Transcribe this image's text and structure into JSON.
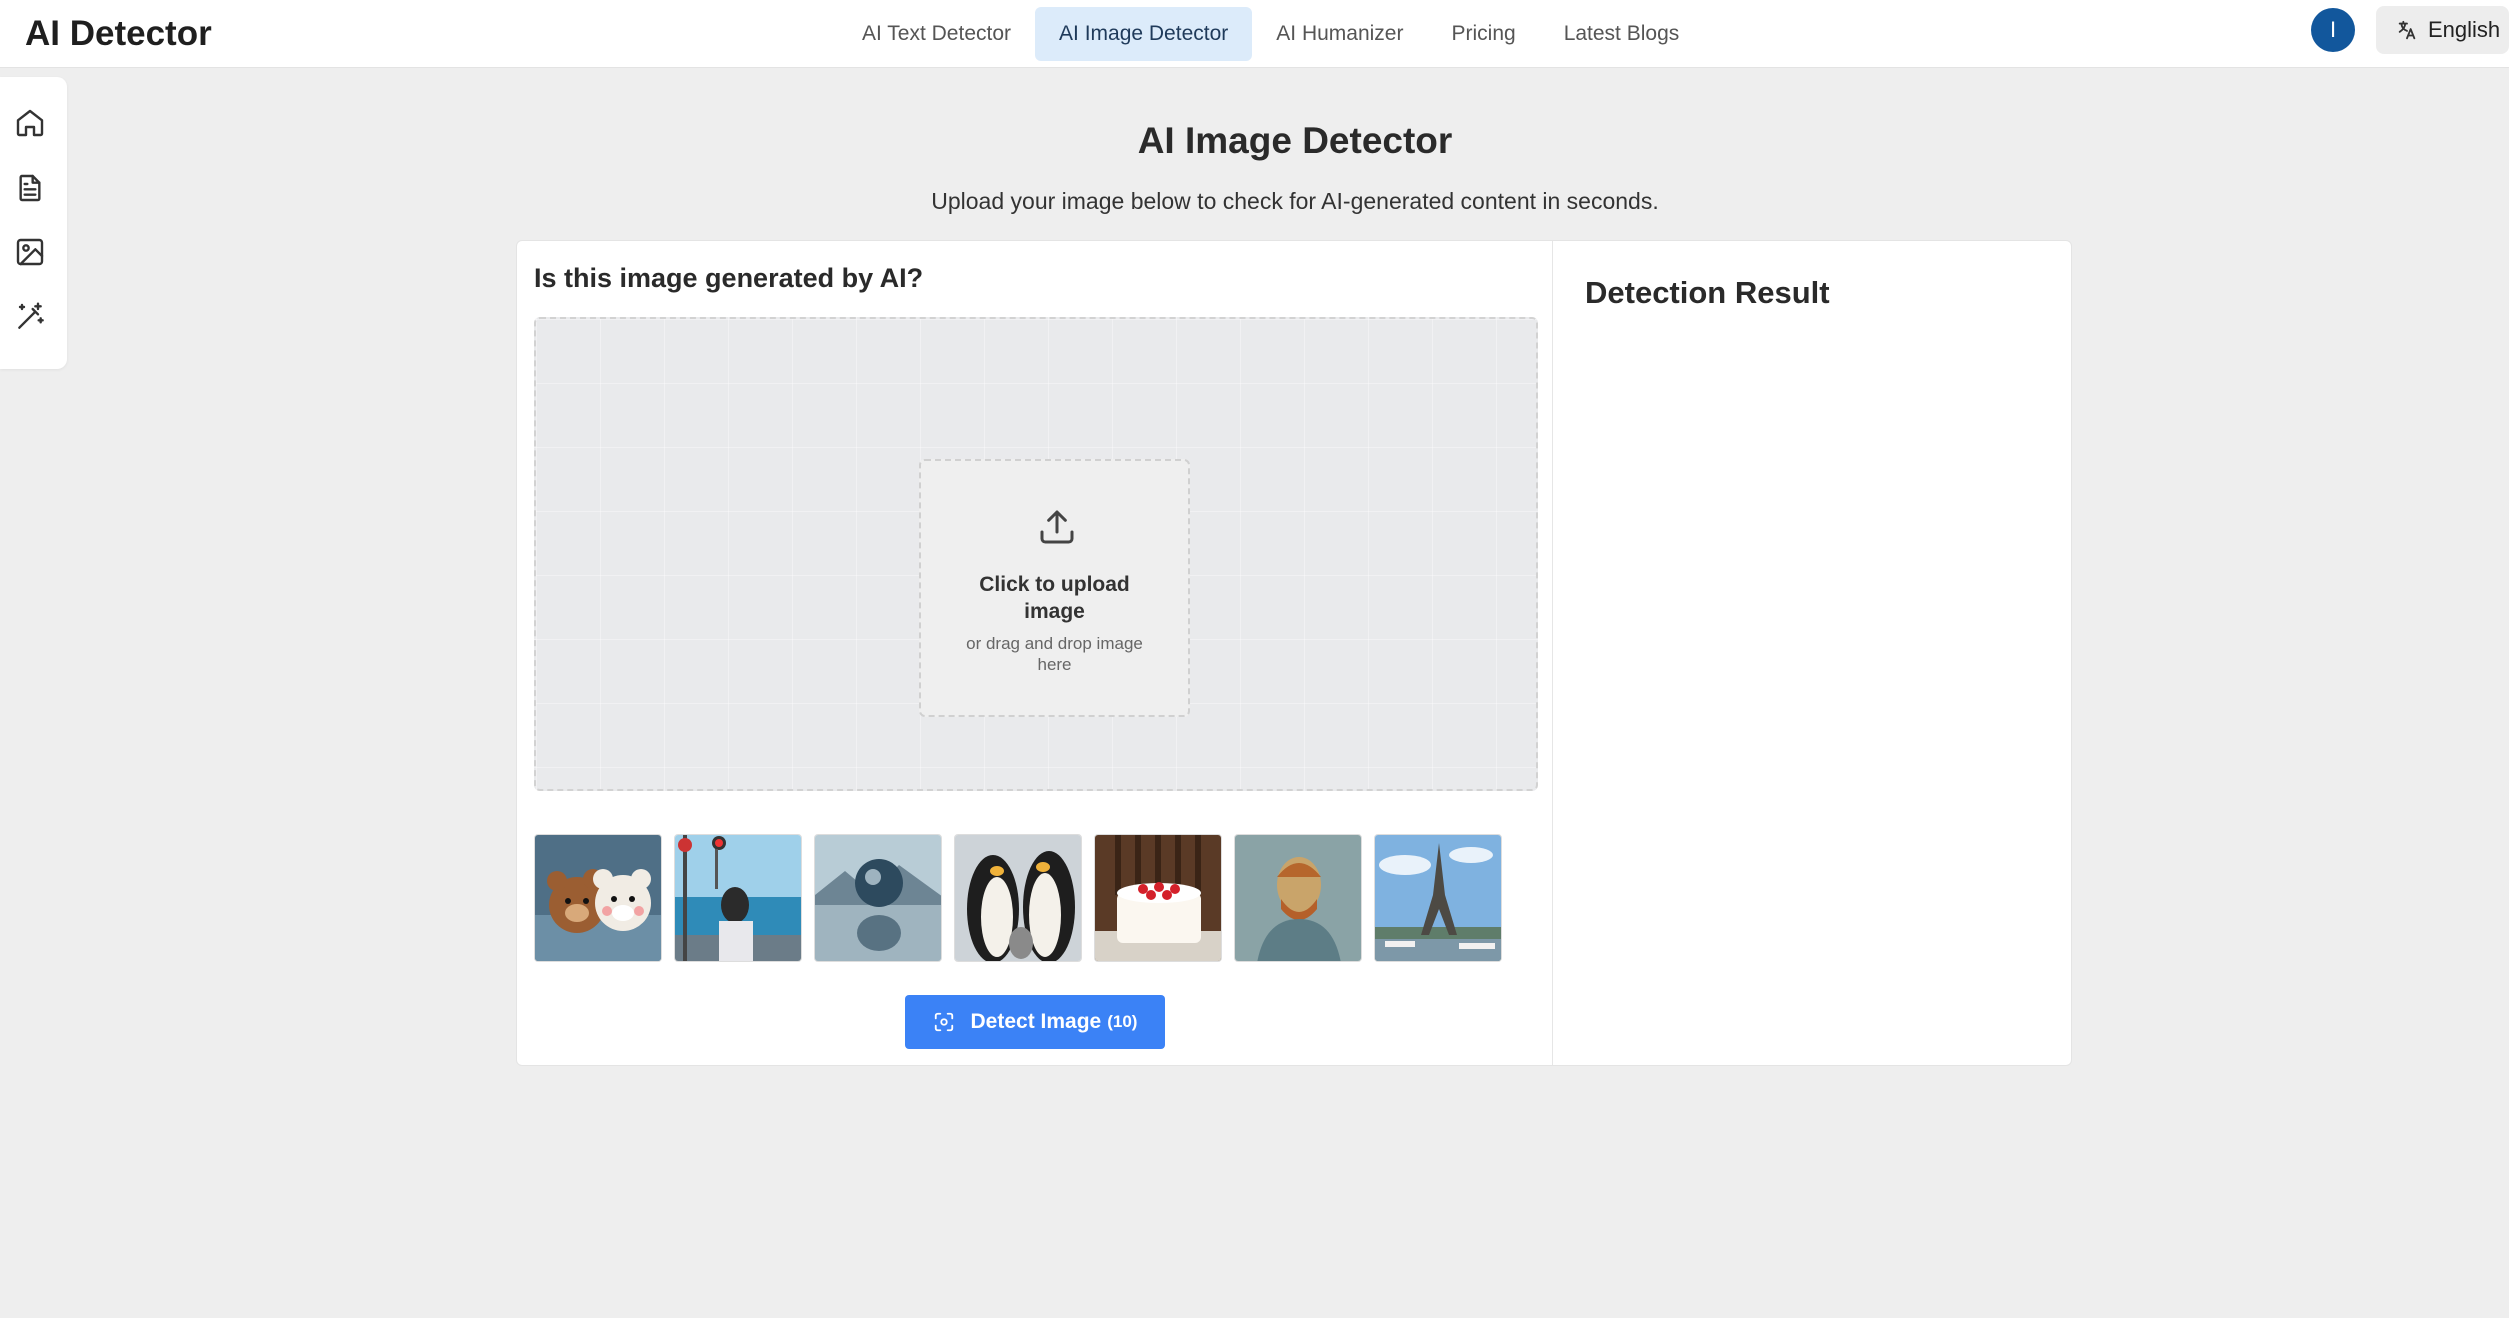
{
  "header": {
    "logo": "AI Detector",
    "nav": [
      {
        "label": "AI Text Detector",
        "active": false
      },
      {
        "label": "AI Image Detector",
        "active": true
      },
      {
        "label": "AI Humanizer",
        "active": false
      },
      {
        "label": "Pricing",
        "active": false
      },
      {
        "label": "Latest Blogs",
        "active": false
      }
    ],
    "avatar_initial": "I",
    "language": "English"
  },
  "sidebar": {
    "icons": [
      "home-icon",
      "document-icon",
      "image-icon",
      "magic-wand-icon"
    ]
  },
  "main": {
    "title": "AI Image Detector",
    "subtitle": "Upload your image below to check for AI-generated content in seconds.",
    "question": "Is this image generated by AI?",
    "upload": {
      "title": "Click to upload image",
      "subtitle": "or drag and drop image here"
    },
    "sample_images": [
      "bears-in-water",
      "girl-by-sea",
      "crystal-ball-reflection",
      "penguins",
      "strawberry-cake",
      "self-portrait-painting",
      "eiffel-tower"
    ],
    "detect_button": {
      "label": "Detect Image",
      "count": "(10)"
    }
  },
  "result": {
    "title": "Detection Result"
  },
  "colors": {
    "accent": "#3b82f6",
    "nav_active_bg": "#dcebfa",
    "avatar": "#12579c",
    "background": "#eeeeee"
  }
}
